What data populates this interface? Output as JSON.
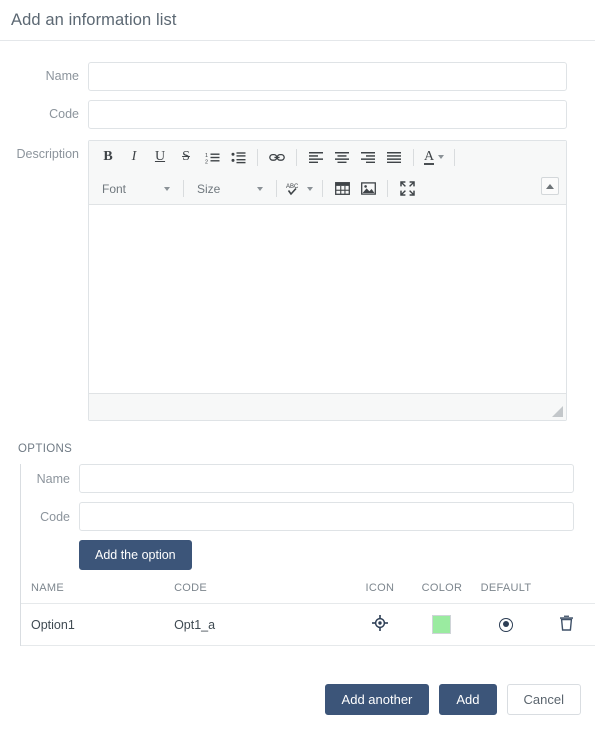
{
  "header": {
    "title": "Add an information list"
  },
  "form": {
    "name": {
      "label": "Name",
      "value": "",
      "placeholder": ""
    },
    "code": {
      "label": "Code",
      "value": "",
      "placeholder": ""
    },
    "description": {
      "label": "Description",
      "value": "",
      "placeholder": ""
    }
  },
  "editor": {
    "toolbar_row1": [
      {
        "name": "bold-icon",
        "label": "B"
      },
      {
        "name": "italic-icon",
        "label": "I"
      },
      {
        "name": "underline-icon",
        "label": "U"
      },
      {
        "name": "strikethrough-icon",
        "label": "S"
      },
      {
        "name": "ordered-list-icon",
        "label": ""
      },
      {
        "name": "unordered-list-icon",
        "label": ""
      },
      {
        "name": "link-icon",
        "label": ""
      },
      {
        "name": "align-left-icon",
        "label": ""
      },
      {
        "name": "align-center-icon",
        "label": ""
      },
      {
        "name": "align-right-icon",
        "label": ""
      },
      {
        "name": "align-justify-icon",
        "label": ""
      },
      {
        "name": "font-color-icon",
        "label": "A"
      }
    ],
    "font_dropdown": {
      "label": "Font",
      "value": "Font"
    },
    "size_dropdown": {
      "label": "Size",
      "value": "Size"
    },
    "spellcheck_label": "ABC",
    "toolbar_row2_icons": [
      {
        "name": "spellcheck-icon",
        "label": "ABC"
      },
      {
        "name": "table-icon",
        "label": ""
      },
      {
        "name": "image-icon",
        "label": ""
      },
      {
        "name": "fullscreen-icon",
        "label": ""
      }
    ],
    "content": "",
    "collapse_title": "Collapse toolbar"
  },
  "options": {
    "section_title": "OPTIONS",
    "name": {
      "label": "Name",
      "value": "",
      "placeholder": ""
    },
    "code": {
      "label": "Code",
      "value": "",
      "placeholder": ""
    },
    "add_option_label": "Add the option",
    "table": {
      "columns": [
        "NAME",
        "CODE",
        "ICON",
        "COLOR",
        "DEFAULT",
        ""
      ],
      "rows": [
        {
          "name": "Option1",
          "code": "Opt1_a",
          "icon": "crosshair-icon",
          "color": "#9aeba0",
          "default": true,
          "delete_icon": "trash-icon"
        }
      ]
    }
  },
  "footer": {
    "add_another_label": "Add another",
    "add_label": "Add",
    "cancel_label": "Cancel"
  },
  "colors": {
    "primary": "#3c5579",
    "title": "#5c6873",
    "label": "#8c949c",
    "swatch_green": "#9aeba0"
  }
}
